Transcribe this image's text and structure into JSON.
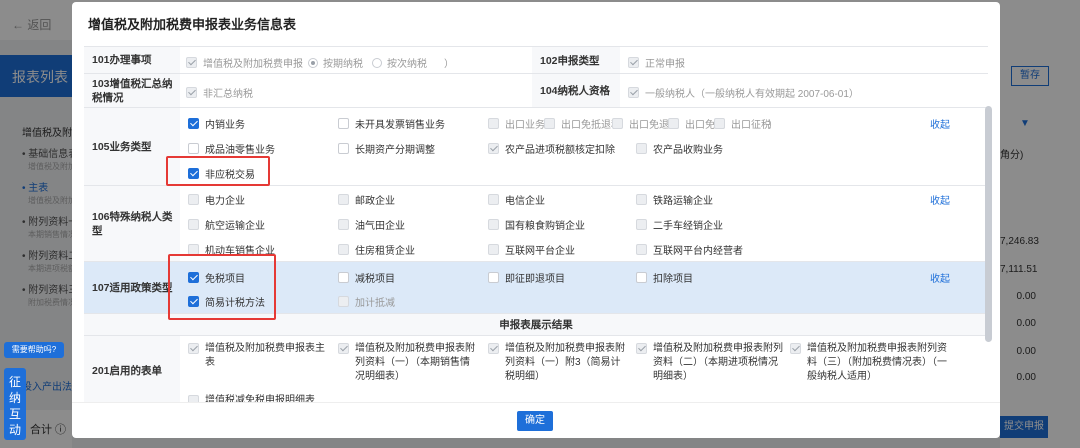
{
  "background": {
    "back_label": "← 返回",
    "page_title": "报表列表",
    "pause_label": "暂存",
    "unit_label": "角分)",
    "left_group": "增值税及附加",
    "left_items": [
      {
        "label": "基础信息表",
        "sub": "增值税及附加"
      },
      {
        "label": "主表",
        "sub": "增值税及附加"
      },
      {
        "label": "附列资料一",
        "sub": "本期销售情况"
      },
      {
        "label": "附列资料二",
        "sub": "本期进项税额"
      },
      {
        "label": "附列资料三",
        "sub": "附加税费情况"
      }
    ],
    "values": [
      "7,246.83",
      "7,111.51",
      "0.00",
      "0.00",
      "0.00",
      "0.00"
    ],
    "submit_label": "提交申报",
    "total_label": "合计 ⓘ",
    "tag_label": "投入产出法",
    "help_bubble": "需要帮助吗?",
    "help_side": "征纳互动"
  },
  "modal": {
    "title": "增值税及附加税费申报表业务信息表",
    "ok_label": "确定",
    "collapse_label": "收起",
    "row101": {
      "label": "101办理事项",
      "check_label": "增值税及附加税费申报（",
      "radio1": "按期纳税",
      "radio2": "按次纳税",
      "close_paren": "）",
      "label2": "102申报类型",
      "value2": "正常申报"
    },
    "row103": {
      "label": "103增值税汇总纳税情况",
      "value": "非汇总纳税",
      "label2": "104纳税人资格",
      "value2": "一般纳税人（一般纳税人有效期起 2007-06-01）"
    },
    "row105": {
      "label": "105业务类型",
      "options": [
        "内销业务",
        "未开具发票销售业务",
        "出口业务（",
        "出口免抵退税",
        "出口免退税",
        "出口免税",
        "出口征税",
        "）",
        "成品油零售业务",
        "长期资产分期调整",
        "农产品进项税额核定扣除",
        "农产品收购业务",
        "非应税交易"
      ]
    },
    "row106": {
      "label": "106特殊纳税人类型",
      "options": [
        "电力企业",
        "邮政企业",
        "电信企业",
        "铁路运输企业",
        "航空运输企业",
        "油气田企业",
        "国有粮食购销企业",
        "二手车经销企业",
        "机动车销售企业",
        "住房租赁企业",
        "互联网平台企业",
        "互联网平台内经营者"
      ]
    },
    "row107": {
      "label": "107适用政策类型",
      "options": [
        "免税项目",
        "减税项目",
        "即征即退项目",
        "扣除项目",
        "简易计税方法",
        "加计抵减"
      ]
    },
    "section_title": "申报表展示结果",
    "row201": {
      "label": "201启用的表单",
      "forms": [
        "增值税及附加税费申报表主表",
        "增值税及附加税费申报表附列资料（一）（本期销售情况明细表）",
        "增值税及附加税费申报表附列资料（一）附3（简易计税明细）",
        "增值税及附加税费申报表附列资料（二）（本期进项税情况明细表）",
        "增值税及附加税费申报表附列资料（三）（附加税费情况表）（一般纳税人适用）",
        "增值税减免税申报明细表"
      ]
    }
  }
}
